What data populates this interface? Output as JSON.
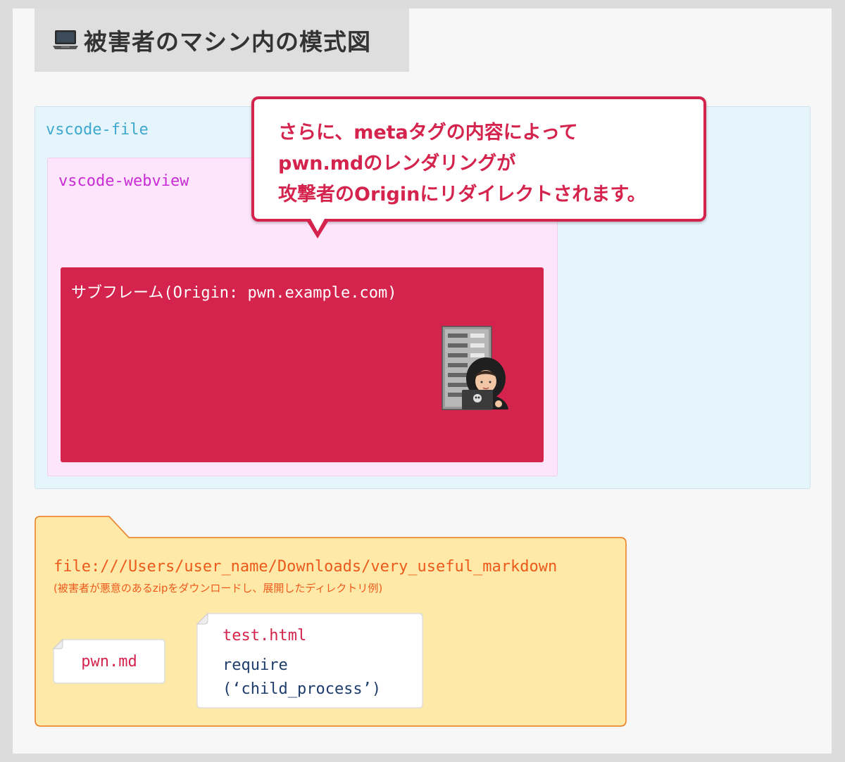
{
  "header": {
    "icon": "laptop-icon",
    "title": "被害者のマシン内の模式図"
  },
  "vscode_file": {
    "label": "vscode-file"
  },
  "vscode_webview": {
    "label": "vscode-webview"
  },
  "subframe": {
    "label": "サブフレーム(Origin: pwn.example.com)",
    "image": "hacker-with-server-illustration"
  },
  "callout": {
    "lines": [
      "さらに、metaタグの内容によって",
      "pwn.mdのレンダリングが",
      "攻撃者のOriginにリダイレクトされます。"
    ]
  },
  "folder": {
    "path": "file:///Users/user_name/Downloads/very_useful_markdown",
    "note": "(被害者が悪意のあるzipをダウンロードし、展開したディレクトリ例)"
  },
  "files": {
    "pwn": {
      "name": "pwn.md"
    },
    "test": {
      "name": "test.html",
      "code_line1": "require",
      "code_line2": "(‘child_process’)"
    }
  },
  "colors": {
    "accent_red": "#d4244d",
    "file_blue": "#3fa8cf",
    "webview_magenta": "#c92bd6",
    "folder_orange": "#ec5a1c",
    "folder_fill": "#ffe9a8"
  }
}
